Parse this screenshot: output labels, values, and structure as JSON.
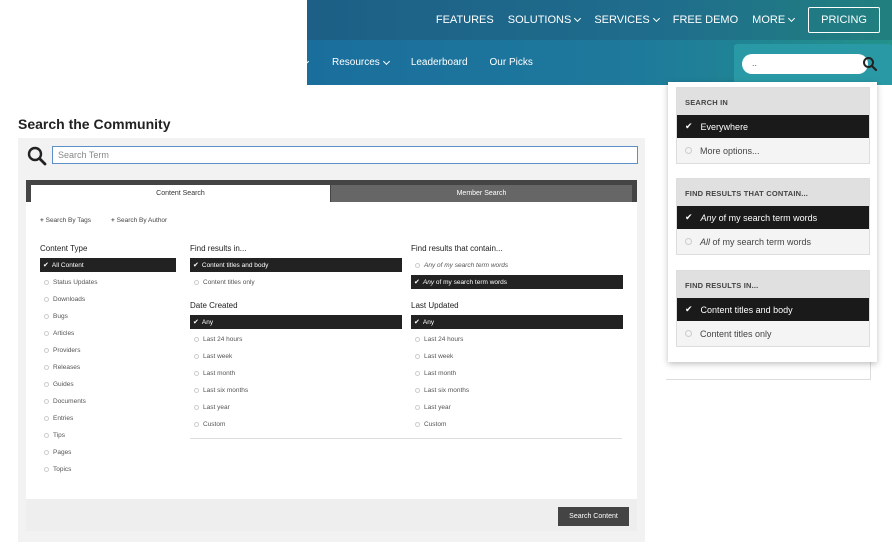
{
  "header": {
    "nav": [
      {
        "label": "FEATURES",
        "dropdown": false
      },
      {
        "label": "SOLUTIONS",
        "dropdown": true
      },
      {
        "label": "SERVICES",
        "dropdown": true
      },
      {
        "label": "FREE DEMO",
        "dropdown": false
      },
      {
        "label": "MORE",
        "dropdown": true
      }
    ],
    "pricing": "PRICING"
  },
  "subnav": {
    "items": [
      {
        "label": "Resources",
        "dropdown": true
      },
      {
        "label": "Leaderboard",
        "dropdown": false
      },
      {
        "label": "Our Picks",
        "dropdown": false
      }
    ],
    "search_value": ".."
  },
  "page": {
    "title": "Search the Community",
    "search_placeholder": "Search Term",
    "tabs": [
      "Content Search",
      "Member Search"
    ],
    "tag_links": [
      "Search By Tags",
      "Search By Author"
    ],
    "content_type": {
      "heading": "Content Type",
      "selected": "All Content",
      "options": [
        "Status Updates",
        "Downloads",
        "Bugs",
        "Articles",
        "Providers",
        "Releases",
        "Guides",
        "Documents",
        "Entries",
        "Tips",
        "Pages",
        "Topics"
      ]
    },
    "find_in": {
      "heading": "Find results in...",
      "selected": "Content titles and body",
      "options": [
        "Content titles only"
      ]
    },
    "contain": {
      "heading": "Find results that contain...",
      "option_any": "Any of my search term words",
      "selected_all_prefix": "Any",
      "selected_all_rest": " of my search term words"
    },
    "date_created": {
      "heading": "Date Created",
      "selected": "Any",
      "options": [
        "Last 24 hours",
        "Last week",
        "Last month",
        "Last six months",
        "Last year",
        "Custom"
      ]
    },
    "last_updated": {
      "heading": "Last Updated",
      "selected": "Any",
      "options": [
        "Last 24 hours",
        "Last week",
        "Last month",
        "Last six months",
        "Last year",
        "Custom"
      ]
    },
    "submit": "Search Content"
  },
  "dropdown": {
    "search_in": {
      "heading": "SEARCH IN",
      "selected": "Everywhere",
      "other": "More options..."
    },
    "contain": {
      "heading": "FIND RESULTS THAT CONTAIN...",
      "selected_em": "Any",
      "selected_rest": " of my search term words",
      "other_em": "All",
      "other_rest": " of my search term words"
    },
    "find_in": {
      "heading": "FIND RESULTS IN...",
      "selected": "Content titles and body",
      "other": "Content titles only"
    }
  },
  "colors": {
    "header_gradient_start": "#1d5f86",
    "header_gradient_end": "#21807f",
    "selected_bg": "#1a1a1a",
    "button_bg": "#444444",
    "input_border": "#5b8fc6"
  }
}
